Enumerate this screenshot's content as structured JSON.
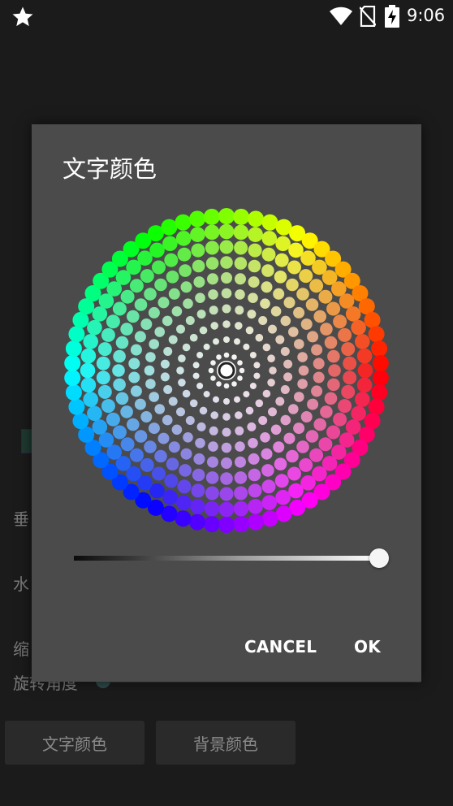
{
  "status_bar": {
    "time": "9:06",
    "icons": [
      "star-icon",
      "wifi-icon",
      "no-sim-icon",
      "battery-charging-icon"
    ]
  },
  "background": {
    "labels": [
      "垂",
      "水",
      "缩"
    ],
    "rotation_label": "旋转角度",
    "text_color_button": "文字颜色",
    "bg_color_button": "背景颜色"
  },
  "dialog": {
    "title": "文字颜色",
    "brightness_value": 1.0,
    "cancel_label": "CANCEL",
    "ok_label": "OK"
  }
}
